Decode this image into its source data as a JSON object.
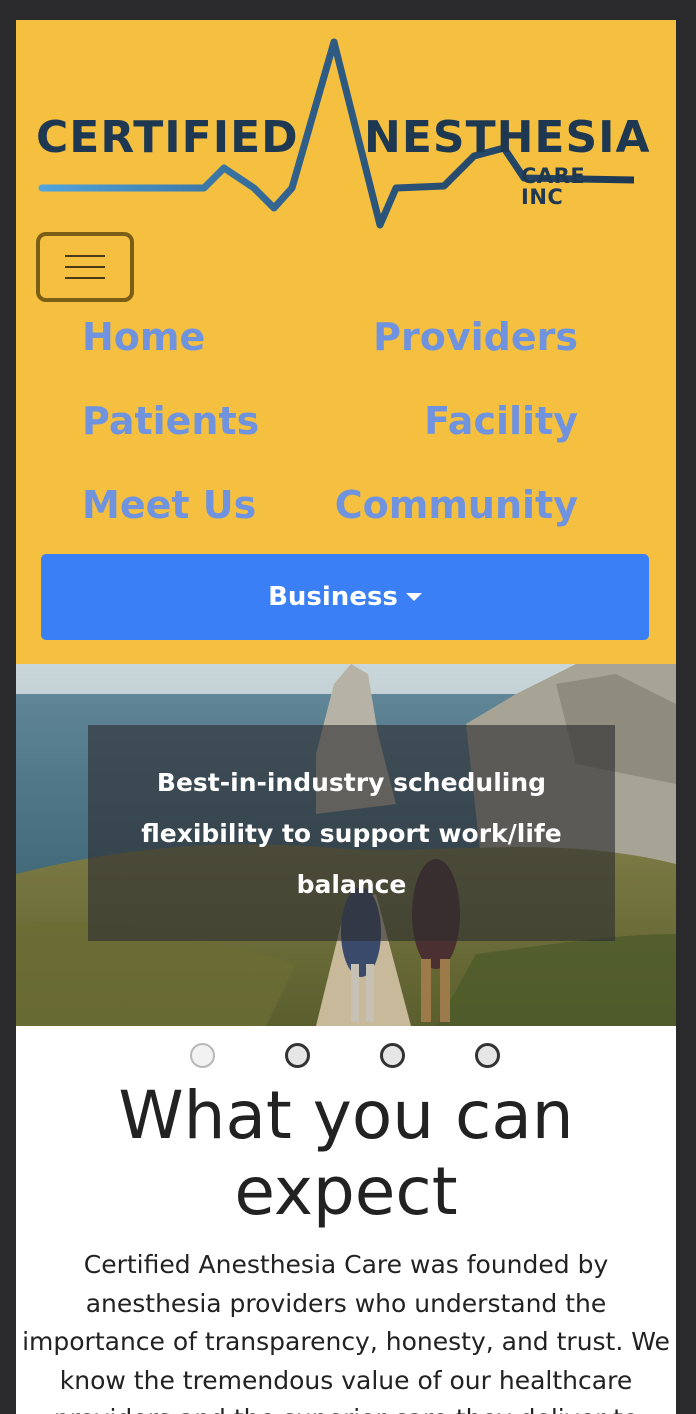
{
  "logo": {
    "word1": "CERTIFIED",
    "letter": "A",
    "word2": "NESTHESIA",
    "sub": "CARE INC",
    "colors": {
      "dark": "#1f3852",
      "mid": "#2f5d87",
      "light": "#52a4dc"
    }
  },
  "nav": {
    "toggler_icon": "hamburger-icon",
    "links": [
      "Home",
      "Providers",
      "Patients",
      "Facility",
      "Meet Us",
      "Community"
    ],
    "dropdown_label": "Business",
    "link_color": "#6f93df",
    "header_bg": "#f5c03f",
    "button_bg": "#3a7ff6"
  },
  "carousel": {
    "caption": "Best-in-industry scheduling flexibility to support work/life balance",
    "slide_count": 4,
    "active_index": 0
  },
  "main": {
    "heading": "What you can expect",
    "paragraph": "Certified Anesthesia Care was founded by anesthesia providers who understand the importance of transparency, honesty, and trust. We know the tremendous value of our healthcare providers and the superior care they deliver to"
  }
}
